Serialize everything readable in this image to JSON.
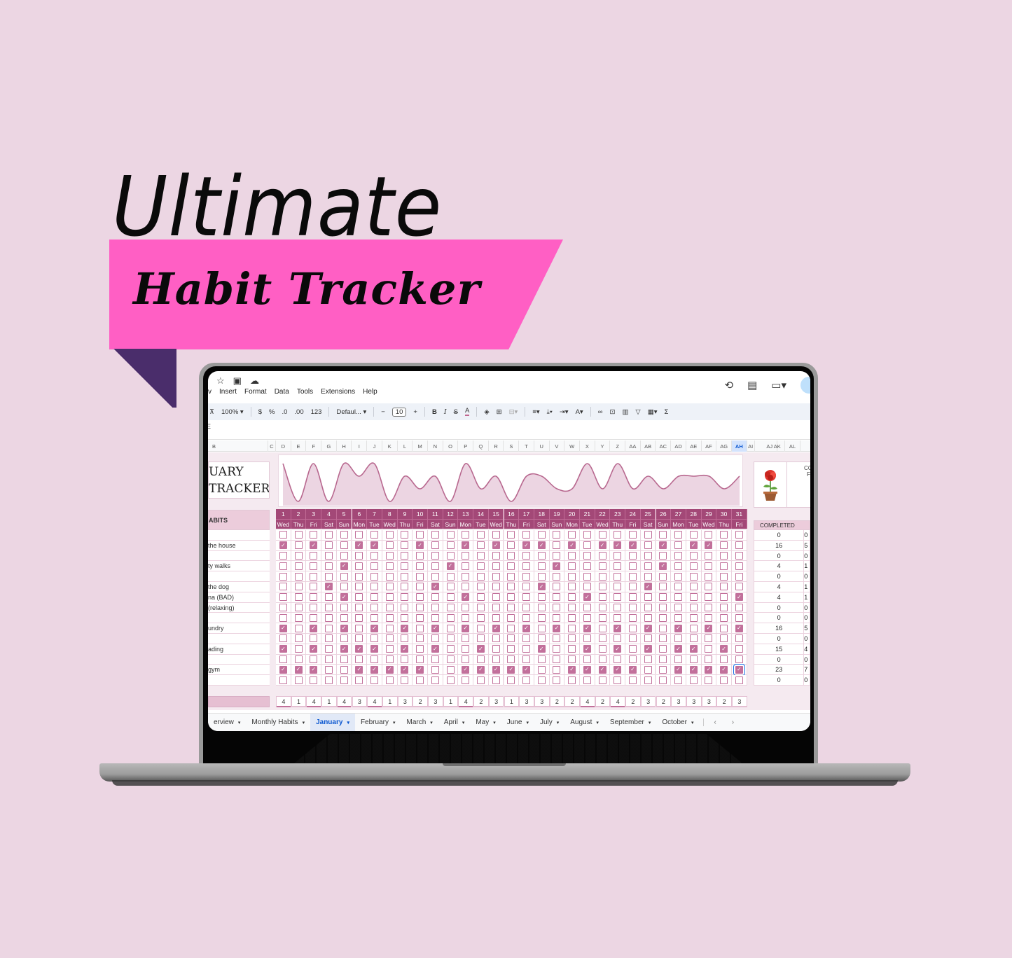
{
  "promo": {
    "title_line1": "Ultimate",
    "title_line2": "Habit Tracker",
    "colors": {
      "background": "#ecd6e3",
      "banner": "#ff5fc4",
      "ribbon_tail": "#4a2d6b",
      "accent": "#a34877",
      "checkbox": "#c2709b"
    }
  },
  "app": {
    "top_icons": [
      "star-icon",
      "move-to-folder-icon",
      "cloud-status-icon"
    ],
    "menu": [
      "v",
      "Insert",
      "Format",
      "Data",
      "Tools",
      "Extensions",
      "Help"
    ],
    "right_icons": [
      "version-history-icon",
      "comments-icon",
      "meet-icon",
      "share-icon"
    ],
    "toolbar": {
      "paint_format": "⊼",
      "zoom": "100%",
      "currency": "$",
      "percent": "%",
      "decrease_decimal": ".0",
      "increase_decimal": ".00",
      "number_format": "123",
      "font": "Defaul...",
      "font_size": "10",
      "minus": "−",
      "plus": "+",
      "bold": "B",
      "italic": "I",
      "strike": "S",
      "text_color": "A",
      "sigma": "Σ"
    },
    "formula_bar_label": "E"
  },
  "sheet": {
    "columns": [
      "B",
      "C",
      "D",
      "E",
      "F",
      "G",
      "H",
      "I",
      "J",
      "K",
      "L",
      "M",
      "N",
      "O",
      "P",
      "Q",
      "R",
      "S",
      "T",
      "U",
      "V",
      "W",
      "X",
      "Y",
      "Z",
      "AA",
      "AB",
      "AC",
      "AD",
      "AE",
      "AF",
      "AG",
      "AH",
      "AI",
      "AJ",
      "AK",
      "AL"
    ],
    "selected_column": "AH",
    "title_line1": "UARY",
    "title_line2": "TRACKER",
    "habits_header": "ABITS",
    "completed_header": "COMPLETED",
    "side_header_partial": "CO",
    "side_header_partial2": "F",
    "plant_icon": "potted-rose-icon",
    "days": [
      {
        "d": "1",
        "w": "Wed"
      },
      {
        "d": "2",
        "w": "Thu"
      },
      {
        "d": "3",
        "w": "Fri"
      },
      {
        "d": "4",
        "w": "Sat"
      },
      {
        "d": "5",
        "w": "Sun"
      },
      {
        "d": "6",
        "w": "Mon"
      },
      {
        "d": "7",
        "w": "Tue"
      },
      {
        "d": "8",
        "w": "Wed"
      },
      {
        "d": "9",
        "w": "Thu"
      },
      {
        "d": "10",
        "w": "Fri"
      },
      {
        "d": "11",
        "w": "Sat"
      },
      {
        "d": "12",
        "w": "Sun"
      },
      {
        "d": "13",
        "w": "Mon"
      },
      {
        "d": "14",
        "w": "Tue"
      },
      {
        "d": "15",
        "w": "Wed"
      },
      {
        "d": "16",
        "w": "Thu"
      },
      {
        "d": "17",
        "w": "Fri"
      },
      {
        "d": "18",
        "w": "Sat"
      },
      {
        "d": "19",
        "w": "Sun"
      },
      {
        "d": "20",
        "w": "Mon"
      },
      {
        "d": "21",
        "w": "Tue"
      },
      {
        "d": "22",
        "w": "Wed"
      },
      {
        "d": "23",
        "w": "Thu"
      },
      {
        "d": "24",
        "w": "Fri"
      },
      {
        "d": "25",
        "w": "Sat"
      },
      {
        "d": "26",
        "w": "Sun"
      },
      {
        "d": "27",
        "w": "Mon"
      },
      {
        "d": "28",
        "w": "Tue"
      },
      {
        "d": "29",
        "w": "Wed"
      },
      {
        "d": "30",
        "w": "Thu"
      },
      {
        "d": "31",
        "w": "Fri"
      }
    ],
    "habits": [
      {
        "label": "",
        "checked": [],
        "completed": "0",
        "pct": "0"
      },
      {
        "label": " the house",
        "checked": [
          1,
          3,
          6,
          7,
          10,
          13,
          15,
          17,
          18,
          20,
          22,
          23,
          24,
          26,
          28,
          29
        ],
        "completed": "16",
        "pct": "5"
      },
      {
        "label": "",
        "checked": [],
        "completed": "0",
        "pct": "0"
      },
      {
        "label": "ty walks",
        "checked": [
          5,
          12,
          19,
          26
        ],
        "completed": "4",
        "pct": "1"
      },
      {
        "label": "",
        "checked": [],
        "completed": "0",
        "pct": "0"
      },
      {
        "label": " the dog",
        "checked": [
          4,
          11,
          18,
          25
        ],
        "completed": "4",
        "pct": "1"
      },
      {
        "label": "na (BAD)",
        "checked": [
          5,
          13,
          21,
          31
        ],
        "completed": "4",
        "pct": "1"
      },
      {
        "label": "(relaxing)",
        "checked": [],
        "completed": "0",
        "pct": "0"
      },
      {
        "label": "",
        "checked": [],
        "completed": "0",
        "pct": "0"
      },
      {
        "label": "undry",
        "checked": [
          1,
          3,
          5,
          7,
          9,
          11,
          13,
          15,
          17,
          19,
          21,
          23,
          25,
          27,
          29,
          31
        ],
        "completed": "16",
        "pct": "5"
      },
      {
        "label": "",
        "checked": [],
        "completed": "0",
        "pct": "0"
      },
      {
        "label": "ading",
        "checked": [
          1,
          3,
          5,
          6,
          7,
          9,
          11,
          14,
          18,
          21,
          23,
          25,
          27,
          28,
          30
        ],
        "completed": "15",
        "pct": "4"
      },
      {
        "label": "",
        "checked": [],
        "completed": "0",
        "pct": "0"
      },
      {
        "label": "gym",
        "checked": [
          1,
          2,
          3,
          6,
          7,
          8,
          9,
          10,
          13,
          14,
          15,
          16,
          17,
          20,
          21,
          22,
          23,
          24,
          27,
          28,
          29,
          30,
          31
        ],
        "completed": "23",
        "pct": "7"
      },
      {
        "label": "",
        "checked": [],
        "completed": "0",
        "pct": "0"
      }
    ],
    "selected_cell": {
      "row": 13,
      "day": 31
    },
    "daily_totals": [
      "4",
      "1",
      "4",
      "1",
      "4",
      "3",
      "4",
      "1",
      "3",
      "2",
      "3",
      "1",
      "4",
      "2",
      "3",
      "1",
      "3",
      "3",
      "2",
      "2",
      "4",
      "2",
      "4",
      "2",
      "3",
      "2",
      "3",
      "3",
      "3",
      "2",
      "3"
    ]
  },
  "chart_data": {
    "type": "area",
    "title": "",
    "x": [
      1,
      2,
      3,
      4,
      5,
      6,
      7,
      8,
      9,
      10,
      11,
      12,
      13,
      14,
      15,
      16,
      17,
      18,
      19,
      20,
      21,
      22,
      23,
      24,
      25,
      26,
      27,
      28,
      29,
      30,
      31
    ],
    "values": [
      4,
      1,
      4,
      1,
      4,
      3,
      4,
      1,
      3,
      2,
      3,
      1,
      4,
      2,
      3,
      1,
      3,
      3,
      2,
      2,
      4,
      2,
      4,
      2,
      3,
      2,
      3,
      3,
      3,
      2,
      3
    ],
    "xlabel": "",
    "ylabel": "",
    "ylim": [
      1,
      4
    ],
    "grid": false,
    "smooth": true
  },
  "tabs": [
    {
      "label": "erview",
      "active": false
    },
    {
      "label": "Monthly Habits",
      "active": false
    },
    {
      "label": "January",
      "active": true
    },
    {
      "label": "February",
      "active": false
    },
    {
      "label": "March",
      "active": false
    },
    {
      "label": "April",
      "active": false
    },
    {
      "label": "May",
      "active": false
    },
    {
      "label": "June",
      "active": false
    },
    {
      "label": "July",
      "active": false
    },
    {
      "label": "August",
      "active": false
    },
    {
      "label": "September",
      "active": false
    },
    {
      "label": "October",
      "active": false
    }
  ],
  "tab_nav": {
    "prev": "‹",
    "next": "›"
  }
}
